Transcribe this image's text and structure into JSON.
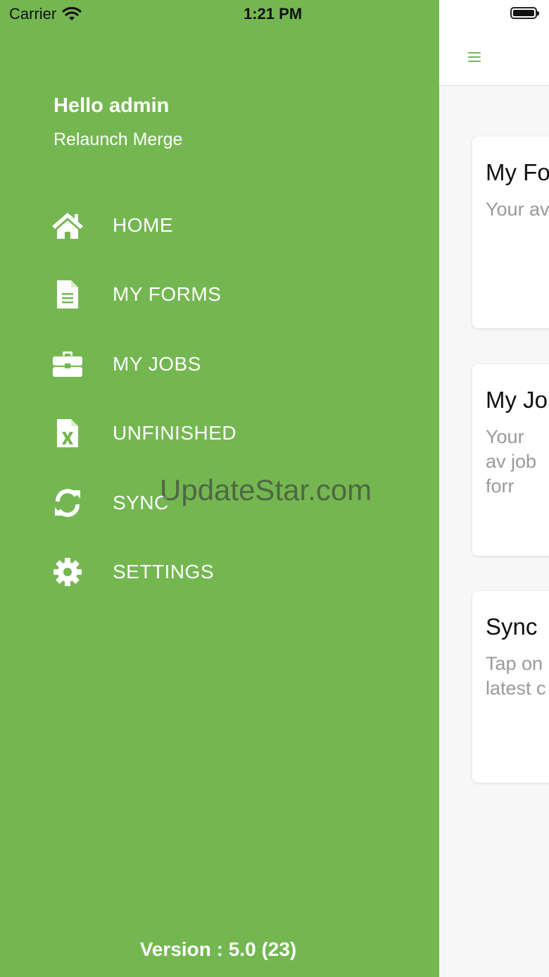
{
  "status_bar": {
    "carrier": "Carrier",
    "time": "1:21 PM"
  },
  "drawer": {
    "greeting": "Hello admin",
    "subtitle": "Relaunch Merge",
    "items": [
      {
        "label": "HOME",
        "icon": "home-icon"
      },
      {
        "label": "MY FORMS",
        "icon": "document-icon"
      },
      {
        "label": "MY JOBS",
        "icon": "briefcase-icon"
      },
      {
        "label": "UNFINISHED",
        "icon": "excel-file-icon"
      },
      {
        "label": "SYNC",
        "icon": "sync-icon"
      },
      {
        "label": "SETTINGS",
        "icon": "gear-icon"
      }
    ],
    "version": "Version : 5.0 (23)",
    "background_color": "#74b751"
  },
  "watermark": "UpdateStar.com",
  "cards": [
    {
      "title": "My Fo",
      "desc": "Your av"
    },
    {
      "title": "My Jol",
      "desc": "Your av job forr"
    },
    {
      "title": "Sync",
      "desc": "Tap on latest c"
    }
  ],
  "accent_color": "#74b751"
}
